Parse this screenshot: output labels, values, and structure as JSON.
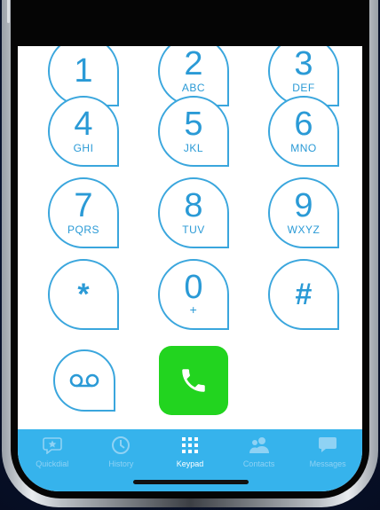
{
  "keypad": {
    "keys": [
      {
        "digit": "1",
        "letters": ""
      },
      {
        "digit": "2",
        "letters": "ABC"
      },
      {
        "digit": "3",
        "letters": "DEF"
      },
      {
        "digit": "4",
        "letters": "GHI"
      },
      {
        "digit": "5",
        "letters": "JKL"
      },
      {
        "digit": "6",
        "letters": "MNO"
      },
      {
        "digit": "7",
        "letters": "PQRS"
      },
      {
        "digit": "8",
        "letters": "TUV"
      },
      {
        "digit": "9",
        "letters": "WXYZ"
      },
      {
        "digit": "*",
        "letters": ""
      },
      {
        "digit": "0",
        "letters": "+"
      },
      {
        "digit": "#",
        "letters": ""
      }
    ],
    "accent_color": "#3aa6dd",
    "call_color": "#22d41f"
  },
  "tabbar": {
    "background": "#36b3ec",
    "active": "Keypad",
    "tabs": [
      {
        "label": "Quickdial",
        "icon": "star-icon"
      },
      {
        "label": "History",
        "icon": "clock-icon"
      },
      {
        "label": "Keypad",
        "icon": "keypad-grid-icon"
      },
      {
        "label": "Contacts",
        "icon": "contacts-icon"
      },
      {
        "label": "Messages",
        "icon": "chat-bubble-icon"
      }
    ]
  }
}
